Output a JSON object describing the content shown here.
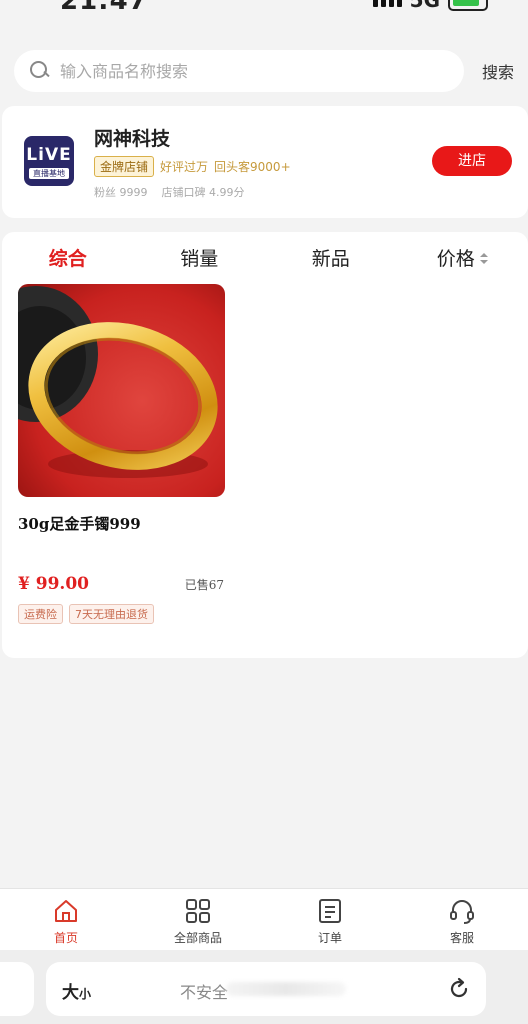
{
  "status": {
    "time": "21:47",
    "network": "5G"
  },
  "search": {
    "placeholder": "输入商品名称搜索",
    "button": "搜索"
  },
  "shop": {
    "logo_top": "LiVE",
    "logo_bottom": "直播基地",
    "name": "网神科技",
    "badge": "金牌店铺",
    "praise": "好评过万",
    "returning": "回头客9000+",
    "fans": "粉丝 9999",
    "rating": "店铺口碑 4.99分",
    "enter_button": "进店"
  },
  "sort_tabs": [
    {
      "label": "综合",
      "active": true
    },
    {
      "label": "销量",
      "active": false
    },
    {
      "label": "新品",
      "active": false
    },
    {
      "label": "价格",
      "active": false
    }
  ],
  "products": [
    {
      "title": "30g足金手镯999",
      "price": "¥ 99.00",
      "sold": "已售67",
      "badges": [
        "运费险",
        "7天无理由退货"
      ]
    }
  ],
  "bottom_nav": [
    {
      "label": "首页",
      "icon": "home-icon",
      "active": true
    },
    {
      "label": "全部商品",
      "icon": "grid-icon",
      "active": false
    },
    {
      "label": "订单",
      "icon": "order-icon",
      "active": false
    },
    {
      "label": "客服",
      "icon": "headset-icon",
      "active": false
    }
  ],
  "browser": {
    "font_size_big": "大",
    "font_size_small": "小",
    "url_label": "不安全"
  },
  "colors": {
    "accent": "#e02020",
    "gold": "#d9b04a",
    "page_bg": "#f3f3f3"
  }
}
